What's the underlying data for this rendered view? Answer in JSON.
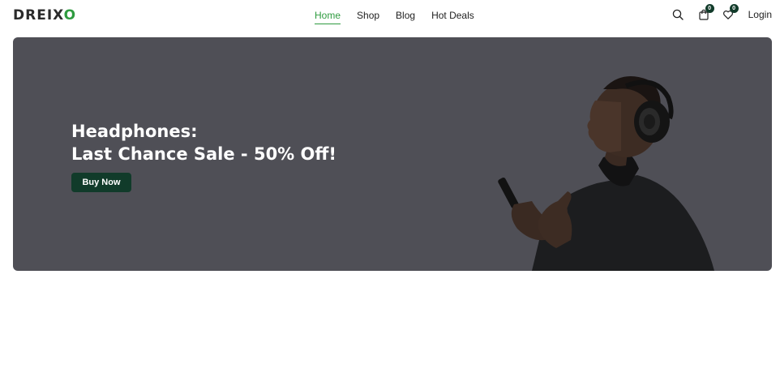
{
  "brand": {
    "logo_main": "DREIX",
    "logo_accent": "O"
  },
  "nav": {
    "links": [
      {
        "label": "Home",
        "active": true
      },
      {
        "label": "Shop",
        "active": false
      },
      {
        "label": "Blog",
        "active": false
      },
      {
        "label": "Hot Deals",
        "active": false
      }
    ],
    "cart_count": "0",
    "wishlist_count": "0",
    "login_label": "Login"
  },
  "hero": {
    "title_line1": "Headphones:",
    "title_line2": "Last Chance Sale - 50% Off!",
    "cta_label": "Buy Now"
  },
  "colors": {
    "accent": "#2e9b3f",
    "dark_green": "#113b2a",
    "hero_bg": "#4f4f56"
  }
}
